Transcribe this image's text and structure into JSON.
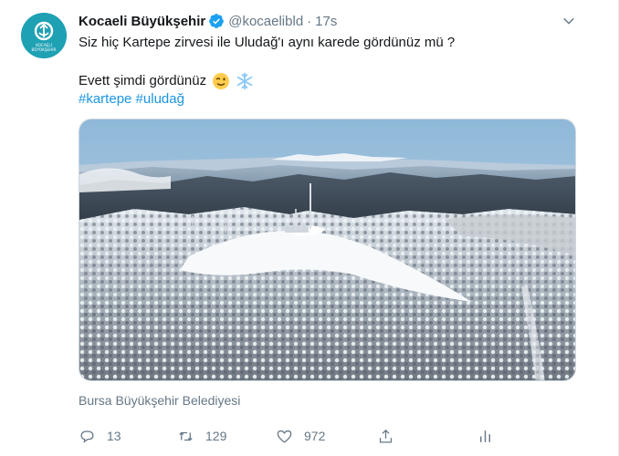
{
  "author": {
    "name": "Kocaeli Büyükşehir",
    "handle": "@kocaelibld",
    "separator": "·",
    "time": "17s",
    "avatar_text": "KOCAELİ BÜYÜKŞEHİR"
  },
  "tweet": {
    "line1": "Siz hiç Kartepe zirvesi ile Uludağ'ı aynı karede gördünüz mü ?",
    "line2": "Evett şimdi gördünüz",
    "hashtags": [
      "#kartepe",
      "#uludağ"
    ]
  },
  "media": {
    "description_icon": "snowy-mountain-aerial-photo"
  },
  "source_credit": "Bursa Büyükşehir Belediyesi",
  "actions": {
    "reply_count": "13",
    "retweet_count": "129",
    "like_count": "972"
  },
  "colors": {
    "accent": "#1b95e0",
    "muted": "#657786",
    "avatar_bg": "#1fa1b4"
  }
}
